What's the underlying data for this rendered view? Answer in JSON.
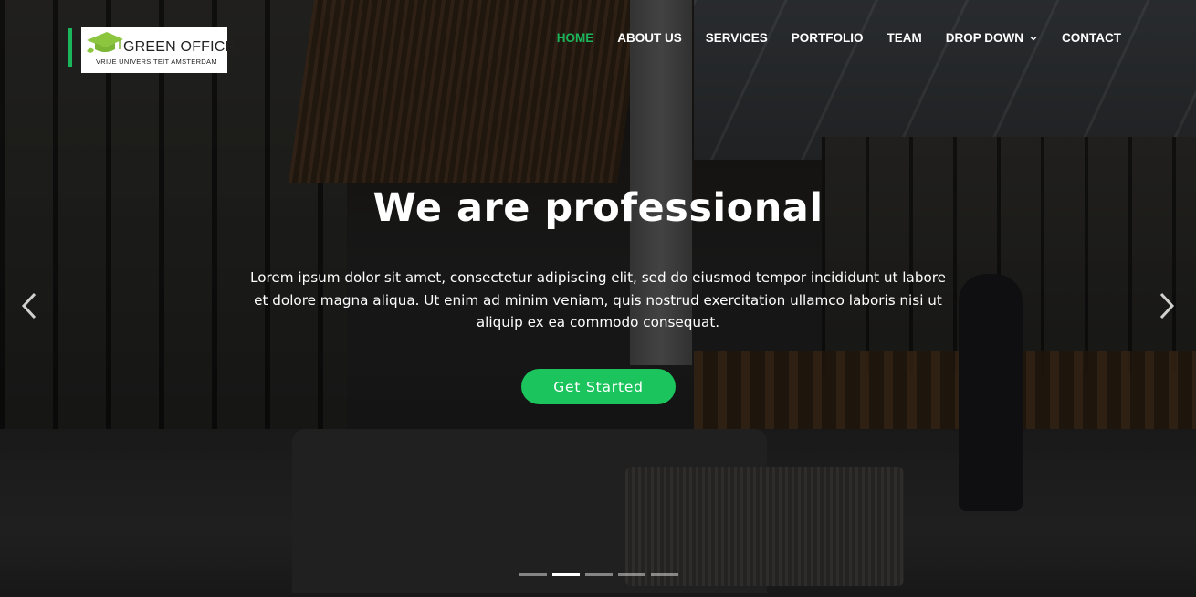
{
  "logo": {
    "title": "GREEN OFFICE",
    "subtitle": "VRIJE UNIVERSITEIT AMSTERDAM",
    "icon": "graduation-cap-icon",
    "accent_color": "#1bb55c"
  },
  "nav": {
    "items": [
      {
        "label": "HOME",
        "active": true
      },
      {
        "label": "ABOUT US",
        "active": false
      },
      {
        "label": "SERVICES",
        "active": false
      },
      {
        "label": "PORTFOLIO",
        "active": false
      },
      {
        "label": "TEAM",
        "active": false
      },
      {
        "label": "DROP DOWN",
        "active": false,
        "icon": "chevron-down-icon"
      },
      {
        "label": "CONTACT",
        "active": false
      }
    ],
    "active_color": "#1bb55c"
  },
  "hero": {
    "title": "We are professional",
    "text": "Lorem ipsum dolor sit amet, consectetur adipiscing elit, sed do eiusmod tempor incididunt ut labore et dolore magna aliqua. Ut enim ad minim veniam, quis nostrud exercitation ullamco laboris nisi ut aliquip ex ea commodo consequat.",
    "cta_label": "Get Started",
    "cta_color": "#1bc45d"
  },
  "carousel": {
    "prev_icon": "chevron-left-icon",
    "next_icon": "chevron-right-icon",
    "slide_count": 5,
    "active_index": 1
  }
}
